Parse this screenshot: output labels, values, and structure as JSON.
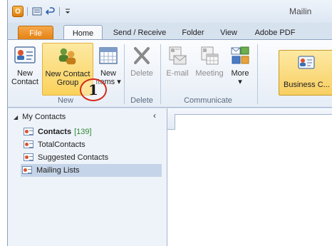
{
  "window": {
    "title": "Mailin",
    "app_icon": "outlook-icon",
    "quick_access": [
      "send-receive-icon",
      "undo-icon",
      "customize-qat-icon"
    ]
  },
  "tabs": {
    "file": "File",
    "home": "Home",
    "send_receive": "Send / Receive",
    "folder": "Folder",
    "view": "View",
    "adobe_pdf": "Adobe PDF"
  },
  "ribbon": {
    "new_group": {
      "label": "New",
      "new_contact": "New\nContact",
      "new_contact_group": "New Contact\nGroup",
      "new_items": "New\nItems ▾"
    },
    "delete_group": {
      "label": "Delete",
      "delete": "Delete"
    },
    "communicate_group": {
      "label": "Communicate",
      "email": "E-mail",
      "meeting": "Meeting",
      "more": "More\n▾"
    },
    "current_view": {
      "business_card": "Business C..."
    }
  },
  "step_badge": "1",
  "nav": {
    "header": "My Contacts",
    "items": [
      {
        "label": "Contacts",
        "count": "[139]",
        "bold": true
      },
      {
        "label": "TotalContacts"
      },
      {
        "label": "Suggested Contacts"
      },
      {
        "label": "Mailing Lists",
        "selected": true
      }
    ]
  },
  "colors": {
    "file_tab": "#e2800f",
    "highlight": "#fbd25c",
    "selection": "#c5d4e8",
    "badge_ring": "#d42a1a",
    "count_green": "#2e8b2e"
  }
}
